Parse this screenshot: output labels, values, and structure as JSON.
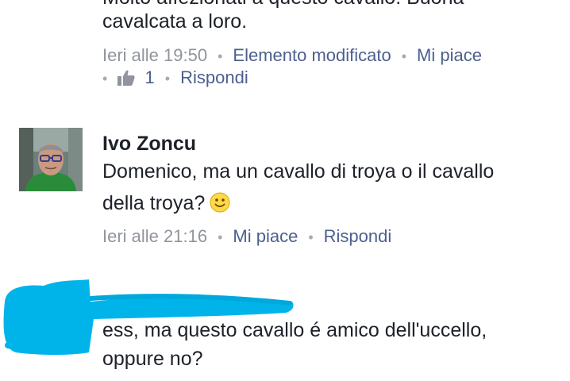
{
  "comment1": {
    "text_line1": "Molto affezionati a questo cavallo. Buona",
    "text_line2": "cavalcata a loro.",
    "timestamp": "Ieri alle 19:50",
    "edited": "Elemento modificato",
    "like_action": "Mi piace",
    "like_count": "1",
    "reply_action": "Rispondi"
  },
  "comment2": {
    "author": "Ivo Zoncu",
    "text_line1": "Domenico, ma un cavallo di troya o il cavallo",
    "text_line2": "della troya?",
    "emoji": "smiley-emoji",
    "timestamp": "Ieri alle 21:16",
    "like_action": "Mi piace",
    "reply_action": "Rispondi"
  },
  "comment3": {
    "text_line1": "ess, ma questo cavallo é amico dell'uccello,",
    "text_line2": "oppure no?",
    "redaction_color": "#00b4ea"
  },
  "colors": {
    "text": "#1d2129",
    "meta_gray": "#90949c",
    "link_blue": "#4b5f8e",
    "background": "#ffffff"
  }
}
